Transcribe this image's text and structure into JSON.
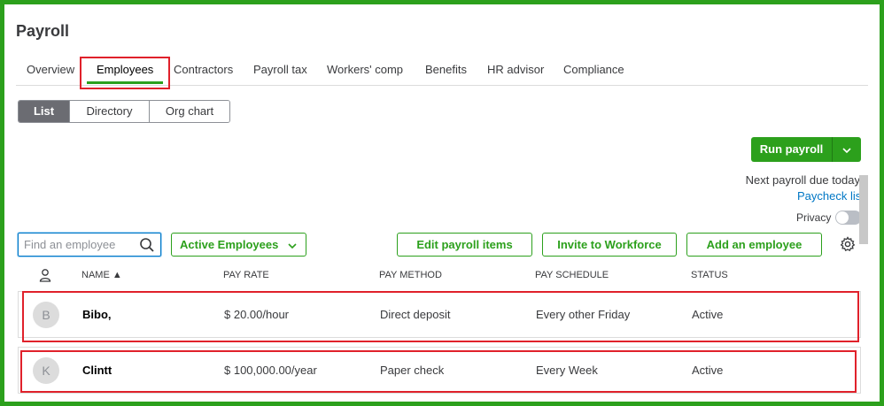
{
  "page": {
    "title": "Payroll"
  },
  "tabs": [
    {
      "label": "Overview"
    },
    {
      "label": "Employees"
    },
    {
      "label": "Contractors"
    },
    {
      "label": "Payroll tax"
    },
    {
      "label": "Workers' comp"
    },
    {
      "label": "Benefits"
    },
    {
      "label": "HR advisor"
    },
    {
      "label": "Compliance"
    }
  ],
  "view_toggle": {
    "list": "List",
    "directory": "Directory",
    "org_chart": "Org chart",
    "selected": "List"
  },
  "run_payroll": {
    "label": "Run payroll"
  },
  "payroll_info": {
    "due": "Next payroll due today",
    "paycheck_list": "Paycheck list",
    "privacy": "Privacy"
  },
  "search": {
    "placeholder": "Find an employee"
  },
  "filter": {
    "label": "Active Employees"
  },
  "actions": {
    "edit_items": "Edit payroll items",
    "invite": "Invite to Workforce",
    "add_employee": "Add an employee"
  },
  "table": {
    "headers": {
      "name": "NAME ▲",
      "pay_rate": "PAY RATE",
      "pay_method": "PAY METHOD",
      "pay_schedule": "PAY SCHEDULE",
      "status": "STATUS"
    },
    "rows": [
      {
        "initial": "B",
        "name": "Bibo,",
        "pay_rate": "$ 20.00/hour",
        "pay_method": "Direct deposit",
        "pay_schedule": "Every other Friday",
        "status": "Active"
      },
      {
        "initial": "K",
        "name": "Clintt",
        "pay_rate": "$ 100,000.00/year",
        "pay_method": "Paper check",
        "pay_schedule": "Every Week",
        "status": "Active"
      }
    ]
  },
  "colors": {
    "brand_green": "#2ca01c",
    "highlight_red": "#e0212b",
    "link_blue": "#0077c5"
  }
}
